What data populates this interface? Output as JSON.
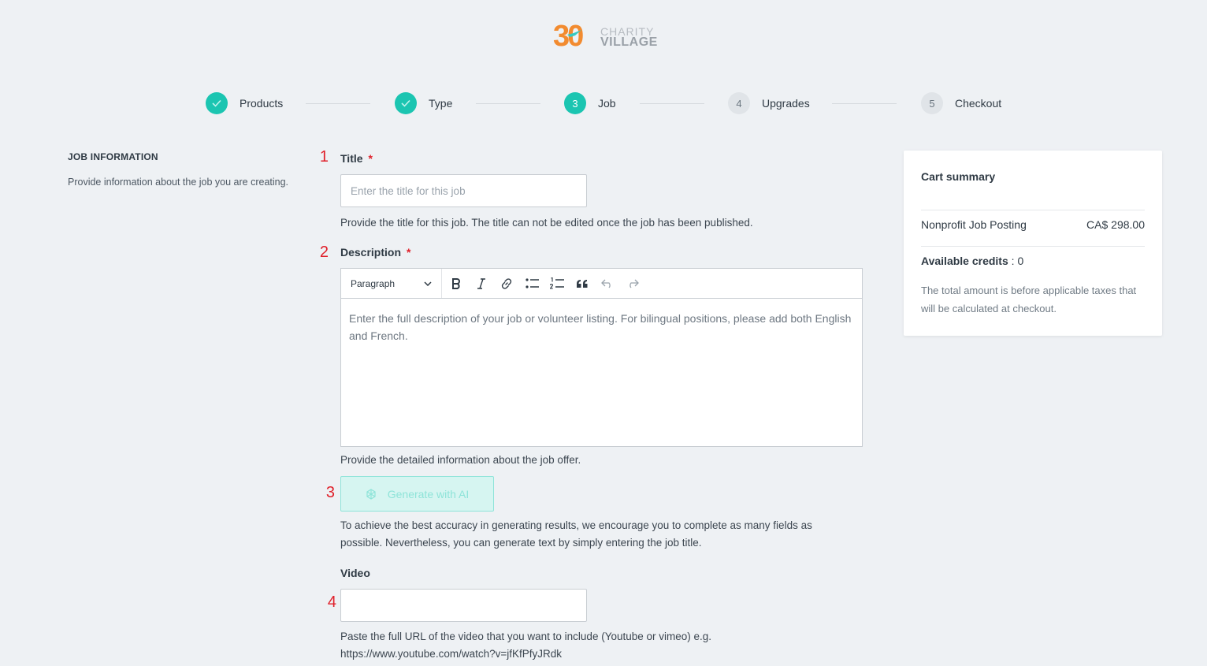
{
  "logo": {
    "number": "30",
    "line1": "CHARITY",
    "line2": "VILLAGE"
  },
  "stepper": [
    {
      "marker": "",
      "label": "Products",
      "state": "done"
    },
    {
      "marker": "",
      "label": "Type",
      "state": "done"
    },
    {
      "marker": "3",
      "label": "Job",
      "state": "active"
    },
    {
      "marker": "4",
      "label": "Upgrades",
      "state": "todo"
    },
    {
      "marker": "5",
      "label": "Checkout",
      "state": "todo"
    }
  ],
  "sidebar": {
    "heading": "JOB INFORMATION",
    "text": "Provide information about the job you are creating."
  },
  "annotations": [
    "1",
    "2",
    "3",
    "4"
  ],
  "form": {
    "title": {
      "label": "Title",
      "required": "*",
      "placeholder": "Enter the title for this job",
      "hint": "Provide the title for this job. The title can not be edited once the job has been published."
    },
    "description": {
      "label": "Description",
      "required": "*",
      "block_format": "Paragraph",
      "placeholder": "Enter the full description of your job or volunteer listing. For bilingual positions, please add both English and French.",
      "hint": "Provide the detailed information about the job offer."
    },
    "ai": {
      "button_label": "Generate with AI",
      "hint": "To achieve the best accuracy in generating results, we encourage you to complete as many fields as possible. Nevertheless, you can generate text by simply entering the job title."
    },
    "video": {
      "label": "Video",
      "value": "",
      "hint_line1": "Paste the full URL of the video that you want to include (Youtube or vimeo) e.g.",
      "hint_line2": "https://www.youtube.com/watch?v=jfKfPfyJRdk"
    }
  },
  "cart": {
    "title": "Cart summary",
    "item_name": "Nonprofit Job Posting",
    "item_price": "CA$ 298.00",
    "credits_label": "Available credits",
    "credits_sep": " : ",
    "credits_value": "0",
    "note": "The total amount is before applicable taxes that will be calculated at checkout."
  },
  "colors": {
    "accent": "#1bc5b1",
    "background": "#eef1f4",
    "required": "#e0202a",
    "logo_orange": "#f28b2f"
  },
  "icons": [
    "check-icon",
    "chevron-down-icon",
    "bold-icon",
    "italic-icon",
    "link-icon",
    "bulleted-list-icon",
    "numbered-list-icon",
    "quote-icon",
    "undo-icon",
    "redo-icon",
    "ai-sparkle-icon"
  ]
}
